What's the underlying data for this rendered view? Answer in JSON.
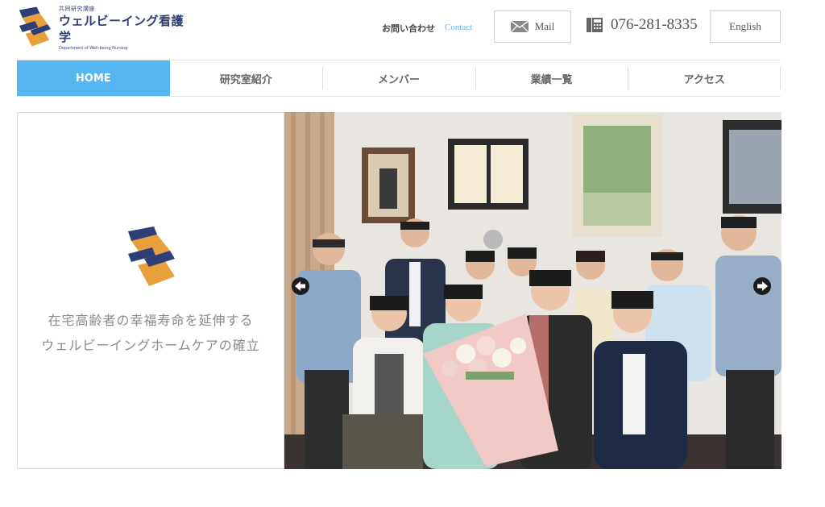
{
  "header": {
    "logo_small": "共同研究講座",
    "logo_main": "ウェルビーイング看護学",
    "logo_sub": "Department of Well-being Nursing",
    "inquiry_label": "お問い合わせ",
    "contact_label": "Contact",
    "mail_label": "Mail",
    "phone": "076-281-8335",
    "english_label": "English"
  },
  "nav": {
    "items": [
      {
        "label": "HOME",
        "active": true
      },
      {
        "label": "研究室紹介",
        "active": false
      },
      {
        "label": "メンバー",
        "active": false
      },
      {
        "label": "業績一覧",
        "active": false
      },
      {
        "label": "アクセス",
        "active": false
      }
    ]
  },
  "hero": {
    "tagline_line1": "在宅高齢者の幸福寿命を延伸する",
    "tagline_line2": "ウェルビーイングホームケアの確立"
  },
  "colors": {
    "accent": "#56b6f1",
    "brand_navy": "#2e3f78",
    "brand_orange": "#e8a03c",
    "contact_link": "#67b3ea"
  }
}
